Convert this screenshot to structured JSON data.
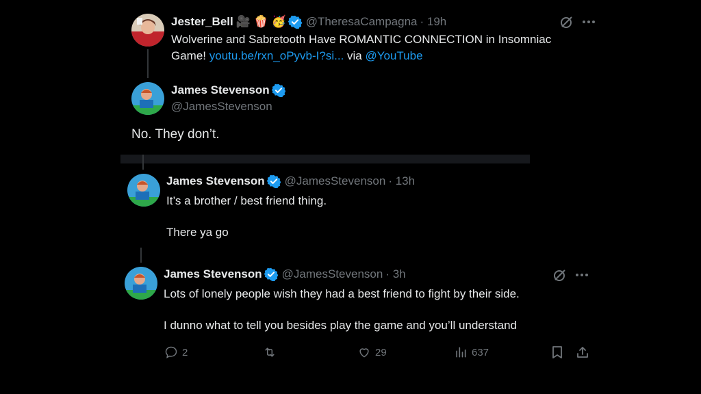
{
  "quoted_tweet": {
    "display_name": "Jester_Bell",
    "emojis": "🎥 🍿 🥳",
    "handle": "@TheresaCampagna",
    "time": "· 19h",
    "line1": "Wolverine and Sabretooth Have ROMANTIC CONNECTION in Insomniac",
    "line2_prefix": "Game! ",
    "link": "youtu.be/rxn_oPyvb-I?si...",
    "via": " via ",
    "mention": "@YouTube"
  },
  "main_reply": {
    "display_name": "James Stevenson",
    "handle": "@JamesStevenson",
    "text": "No. They don’t."
  },
  "reply2": {
    "display_name": "James Stevenson",
    "handle": "@JamesStevenson",
    "time": "· 13h",
    "line1": "It’s a brother / best friend thing.",
    "line2": "There ya go"
  },
  "reply3": {
    "display_name": "James Stevenson",
    "handle": "@JamesStevenson",
    "time": "· 3h",
    "line1": "Lots of lonely people wish they had a best friend to fight by their side.",
    "line2": "I dunno what to tell you besides play the game and you’ll understand",
    "actions": {
      "replies": "2",
      "likes": "29",
      "views": "637"
    }
  },
  "colors": {
    "verified": "#1d9bf0",
    "link": "#1d9bf0",
    "muted": "#71767b"
  }
}
